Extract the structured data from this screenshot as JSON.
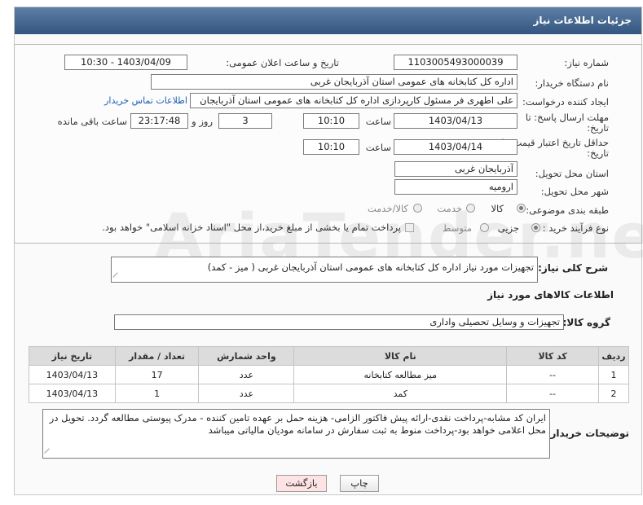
{
  "header": {
    "title": "جزئیات اطلاعات نیاز"
  },
  "form": {
    "need_number": {
      "label": "شماره نیاز:",
      "value": "1103005493000039"
    },
    "announce": {
      "label": "تاریخ و ساعت اعلان عمومی:",
      "value": "1403/04/09 - 10:30"
    },
    "buyer": {
      "label": "نام دستگاه خریدار:",
      "value": "اداره کل کتابخانه های عمومی استان آذربایجان غربی"
    },
    "creator": {
      "label": "ایجاد کننده درخواست:",
      "value": "علی اطهری فر مسئول کارپردازی اداره کل کتابخانه های عمومی استان آذربایجان",
      "contact_link": "اطلاعات تماس خریدار"
    },
    "reply_deadline": {
      "label_line1": "مهلت ارسال پاسخ: تا",
      "label_line2": "تاریخ:",
      "date": "1403/04/13",
      "time_label": "ساعت",
      "time": "10:10",
      "days": "3",
      "days_label": "روز و",
      "remaining": "23:17:48",
      "remaining_label": "ساعت باقی مانده"
    },
    "validity": {
      "label_line1": "حداقل تاریخ اعتبار قیمت: تا",
      "label_line2": "تاریخ:",
      "date": "1403/04/14",
      "time_label": "ساعت",
      "time": "10:10"
    },
    "province": {
      "label": "استان محل تحویل:",
      "value": "آذربایجان غربی"
    },
    "city": {
      "label": "شهر محل تحویل:",
      "value": "ارومیه"
    },
    "category": {
      "label": "طبقه بندی موضوعی:",
      "options": [
        "کالا",
        "خدمت",
        "کالا/خدمت"
      ],
      "selected": "کالا"
    },
    "process": {
      "label": "نوع فرآیند خرید :",
      "options": [
        "جزیی",
        "متوسط"
      ],
      "selected": "جزیی",
      "note": "پرداخت تمام یا بخشی از مبلغ خرید،از محل \"اسناد خزانه اسلامی\" خواهد بود."
    }
  },
  "summary": {
    "label": "شرح کلی نیاز:",
    "value": "تجهیزات مورد نیاز اداره کل کتابخانه های عمومی استان آذربایجان غربی ( میز - کمد)"
  },
  "goods": {
    "section_title": "اطلاعات کالاهای مورد نیاز",
    "group_label": "گروه کالا:",
    "group_value": "تجهیزات و وسایل تحصیلی واداری",
    "columns": [
      "ردیف",
      "کد کالا",
      "نام کالا",
      "واحد شمارش",
      "تعداد / مقدار",
      "تاریخ نیاز"
    ],
    "rows": [
      {
        "idx": "1",
        "code": "--",
        "name": "میز مطالعه کتابخانه",
        "unit": "عدد",
        "qty": "17",
        "date": "1403/04/13"
      },
      {
        "idx": "2",
        "code": "--",
        "name": "کمد",
        "unit": "عدد",
        "qty": "1",
        "date": "1403/04/13"
      }
    ]
  },
  "buyer_notes": {
    "label": "توضیحات خریدار:",
    "value": "ایران کد مشابه-پرداخت نقدی-ارائه پیش فاکتور الزامی- هزینه حمل بر عهده تامین کننده -  مدرک پیوستی مطالعه گردد. تحویل در محل اعلامی خواهد بود-پرداخت منوط به ثبت سفارش در سامانه مودیان مالیاتی میباشد"
  },
  "buttons": {
    "print": "چاپ",
    "back": "بازگشت"
  },
  "watermark": "AriaTender.neT",
  "colors": {
    "header": "#3f6290",
    "link": "#1a5fb4",
    "back_button": "#fde3e3"
  }
}
